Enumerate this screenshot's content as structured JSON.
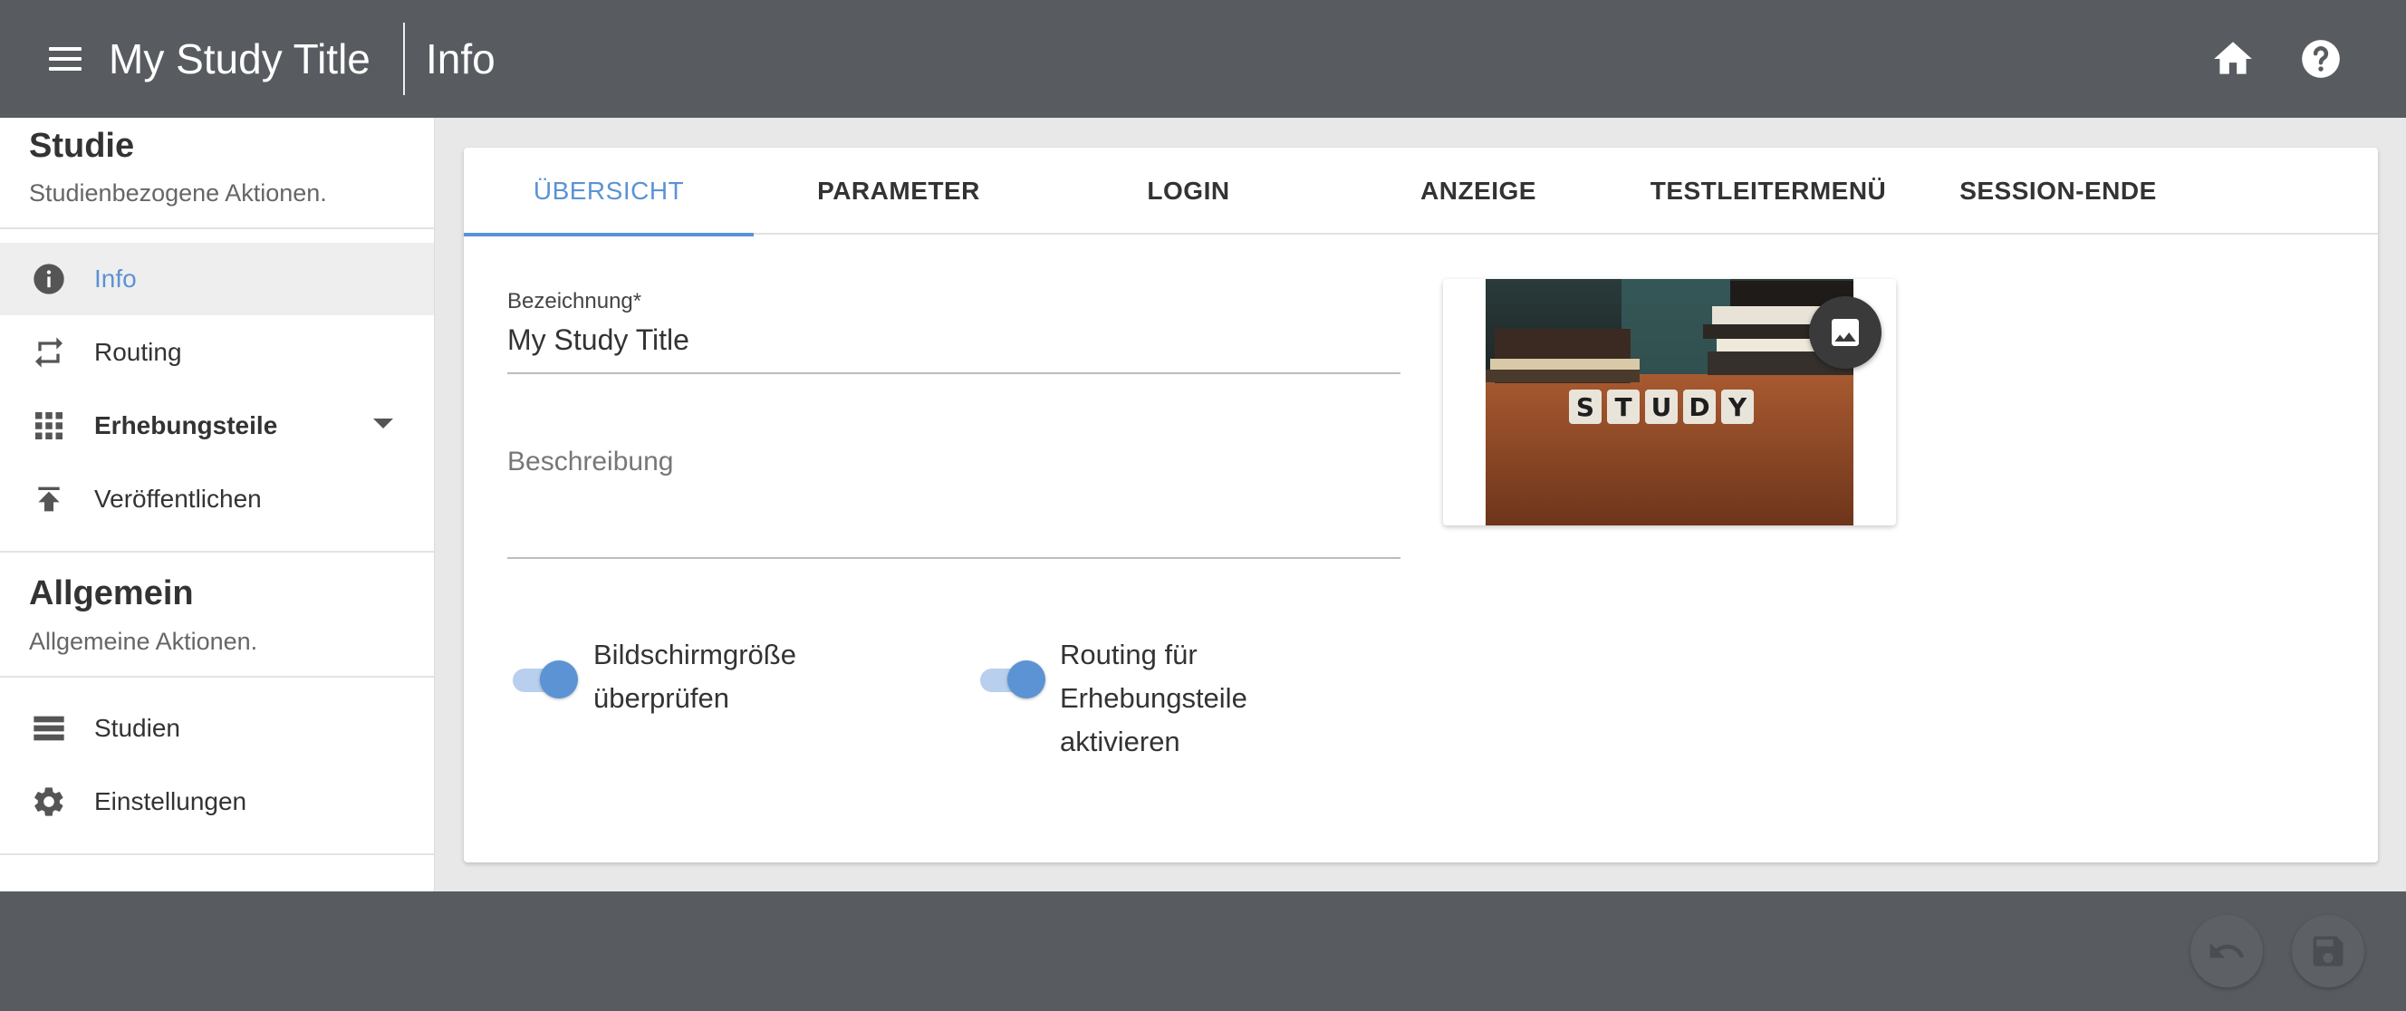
{
  "header": {
    "app_title": "My Study Title",
    "page_title": "Info"
  },
  "sidebar": {
    "sections": [
      {
        "title": "Studie",
        "subtitle": "Studienbezogene Aktionen.",
        "items": [
          {
            "label": "Info",
            "icon": "info-icon",
            "active": true
          },
          {
            "label": "Routing",
            "icon": "routing-icon"
          },
          {
            "label": "Erhebungsteile",
            "icon": "grid-icon",
            "expandable": true
          },
          {
            "label": "Veröffentlichen",
            "icon": "publish-icon"
          }
        ]
      },
      {
        "title": "Allgemein",
        "subtitle": "Allgemeine Aktionen.",
        "items": [
          {
            "label": "Studien",
            "icon": "list-icon"
          },
          {
            "label": "Einstellungen",
            "icon": "gear-icon"
          }
        ]
      }
    ]
  },
  "tabs": [
    "ÜBERSICHT",
    "PARAMETER",
    "LOGIN",
    "ANZEIGE",
    "TESTLEITERMENÜ",
    "SESSION-ENDE"
  ],
  "form": {
    "name_label": "Bezeichnung*",
    "name_value": "My Study Title",
    "description_placeholder": "Beschreibung"
  },
  "toggles": [
    {
      "lines": [
        "Bildschirmgröße",
        "überprüfen"
      ],
      "on": true
    },
    {
      "lines": [
        "Routing für",
        "Erhebungsteile",
        "aktivieren"
      ],
      "on": true
    }
  ],
  "image": {
    "letters": [
      "S",
      "T",
      "U",
      "D",
      "Y"
    ],
    "button_icon": "image-icon"
  },
  "colors": {
    "accent": "#5b93d4",
    "topbar": "#585c61"
  }
}
